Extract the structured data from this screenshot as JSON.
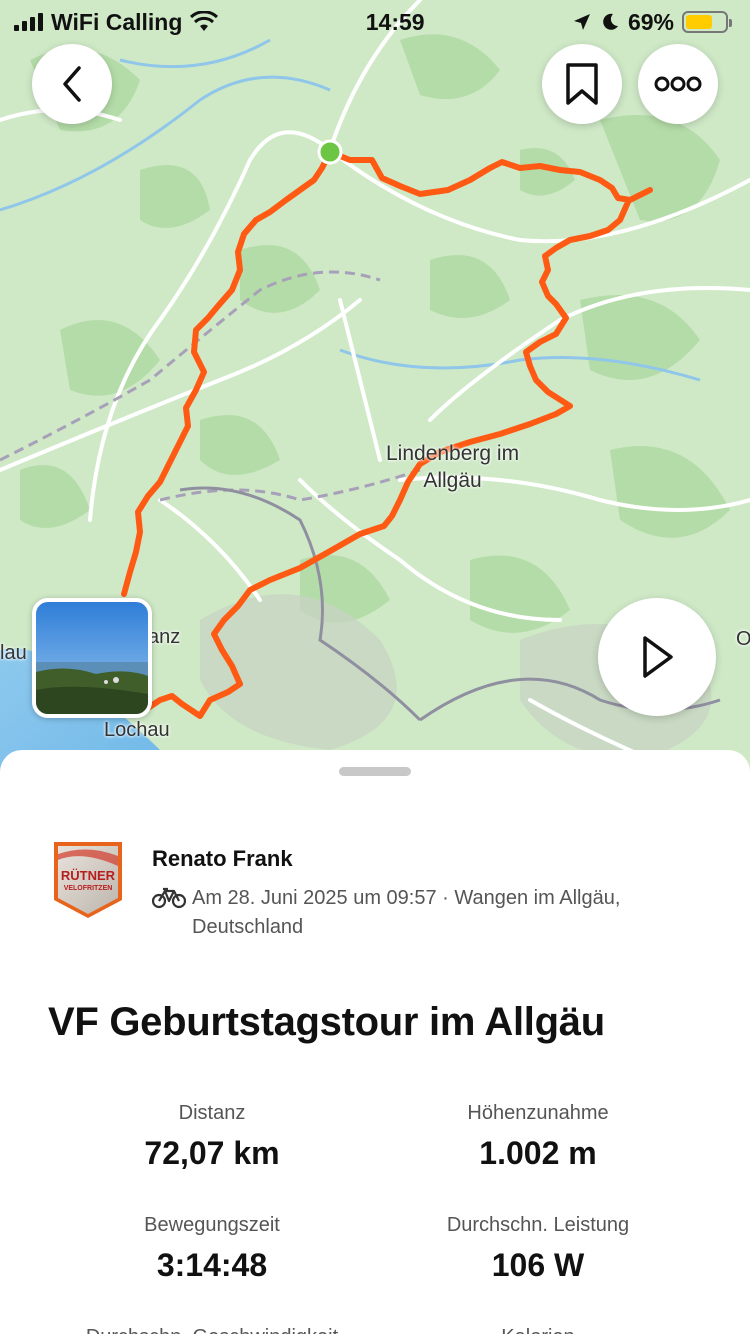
{
  "status_bar": {
    "carrier": "WiFi Calling",
    "time": "14:59",
    "battery": "69%",
    "battery_level": 0.69,
    "battery_color": "#ffcc00"
  },
  "map": {
    "labels": {
      "lindenberg_line1": "Lindenberg im",
      "lindenberg_line2": "Allgäu",
      "lochau": "Lochau",
      "bregenz_partial": "anz",
      "left_partial": "lau",
      "right_partial": "O"
    },
    "route_color": "#ff5a14",
    "start_marker_color": "#6cc644"
  },
  "activity": {
    "athlete_name": "Renato Frank",
    "sport_icon": "bike-icon",
    "date_location": "Am 28. Juni 2025 um 09:57 · Wangen im Allgäu, Deutschland",
    "title": "VF Geburtstagstour im Allgäu",
    "club_badge_text": "RÜTNER",
    "club_badge_subtext": "VELOFRITZEN"
  },
  "stats": [
    {
      "label": "Distanz",
      "value": "72,07 km"
    },
    {
      "label": "Höhenzunahme",
      "value": "1.002 m"
    },
    {
      "label": "Bewegungszeit",
      "value": "3:14:48"
    },
    {
      "label": "Durchschn. Leistung",
      "value": "106 W"
    },
    {
      "label": "Durchschn. Geschwindigkeit",
      "value": ""
    },
    {
      "label": "Kalorien",
      "value": ""
    }
  ]
}
